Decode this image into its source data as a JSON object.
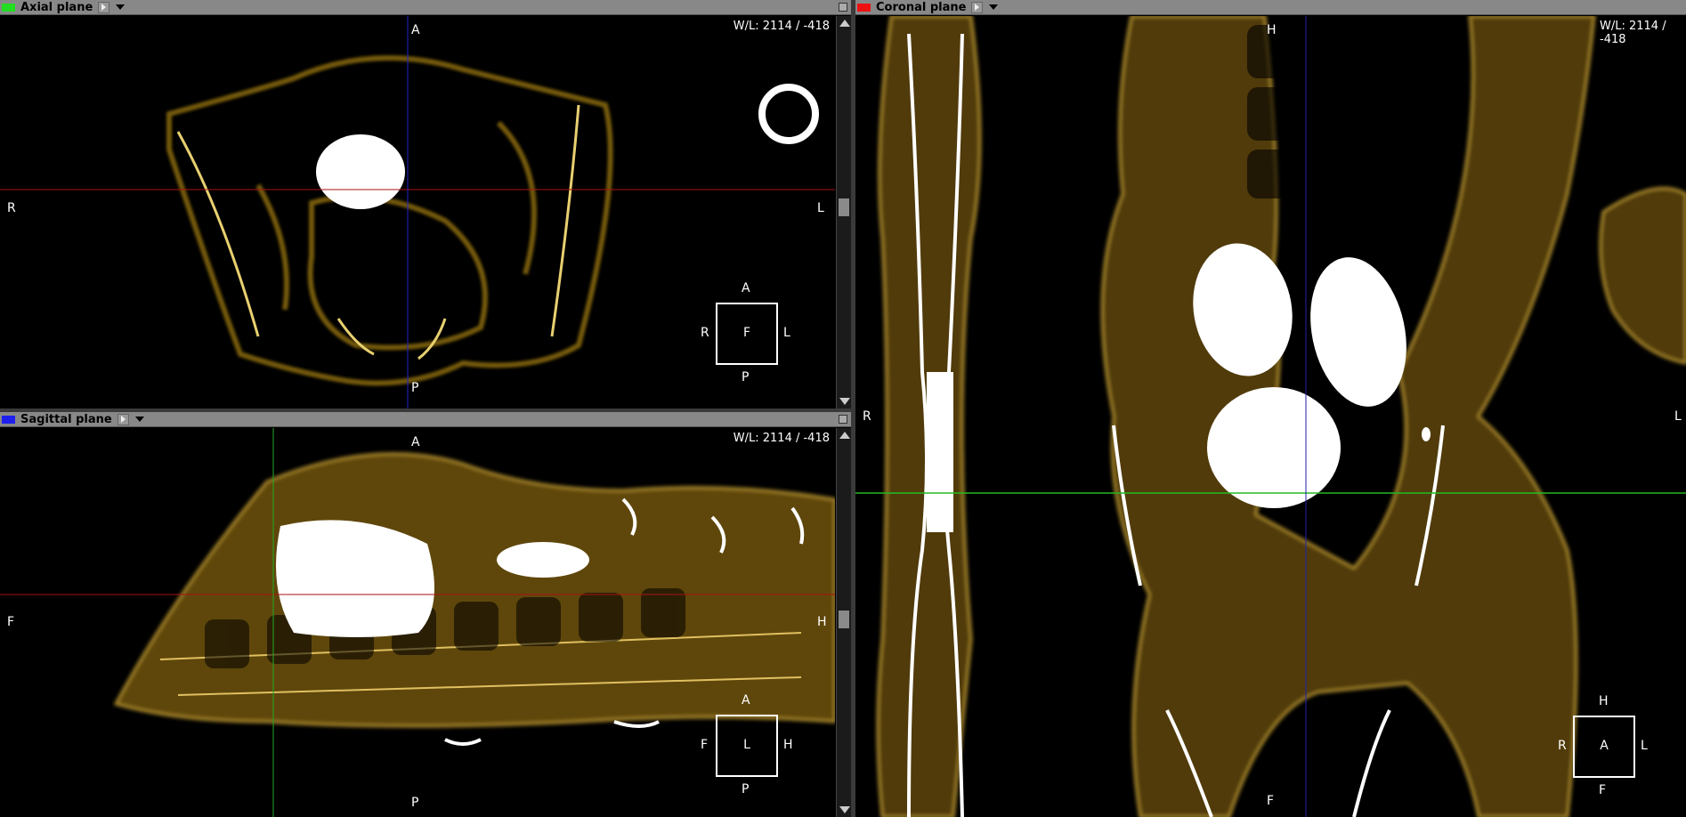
{
  "colors": {
    "axial": "#22dd22",
    "sagittal": "#2020ee",
    "coronal": "#ee1111",
    "bone": "#b08a20"
  },
  "axial": {
    "title": "Axial plane",
    "wl": "W/L: 2114 / -418",
    "labels": {
      "top": "A",
      "bottom": "P",
      "left": "R",
      "right": "L"
    },
    "cube": {
      "top": "A",
      "bottom": "P",
      "left": "R",
      "right": "L",
      "center": "F"
    }
  },
  "sagittal": {
    "title": "Sagittal plane",
    "wl": "W/L: 2114 / -418",
    "labels": {
      "top": "A",
      "bottom": "P",
      "left": "F",
      "right": "H"
    },
    "cube": {
      "top": "A",
      "bottom": "P",
      "left": "F",
      "right": "H",
      "center": "L"
    }
  },
  "coronal": {
    "title": "Coronal plane",
    "wl": "W/L: 2114 / -418",
    "labels": {
      "top": "H",
      "bottom": "F",
      "left": "R",
      "right": "L"
    },
    "cube": {
      "top": "H",
      "bottom": "F",
      "left": "R",
      "right": "L",
      "center": "A"
    }
  }
}
